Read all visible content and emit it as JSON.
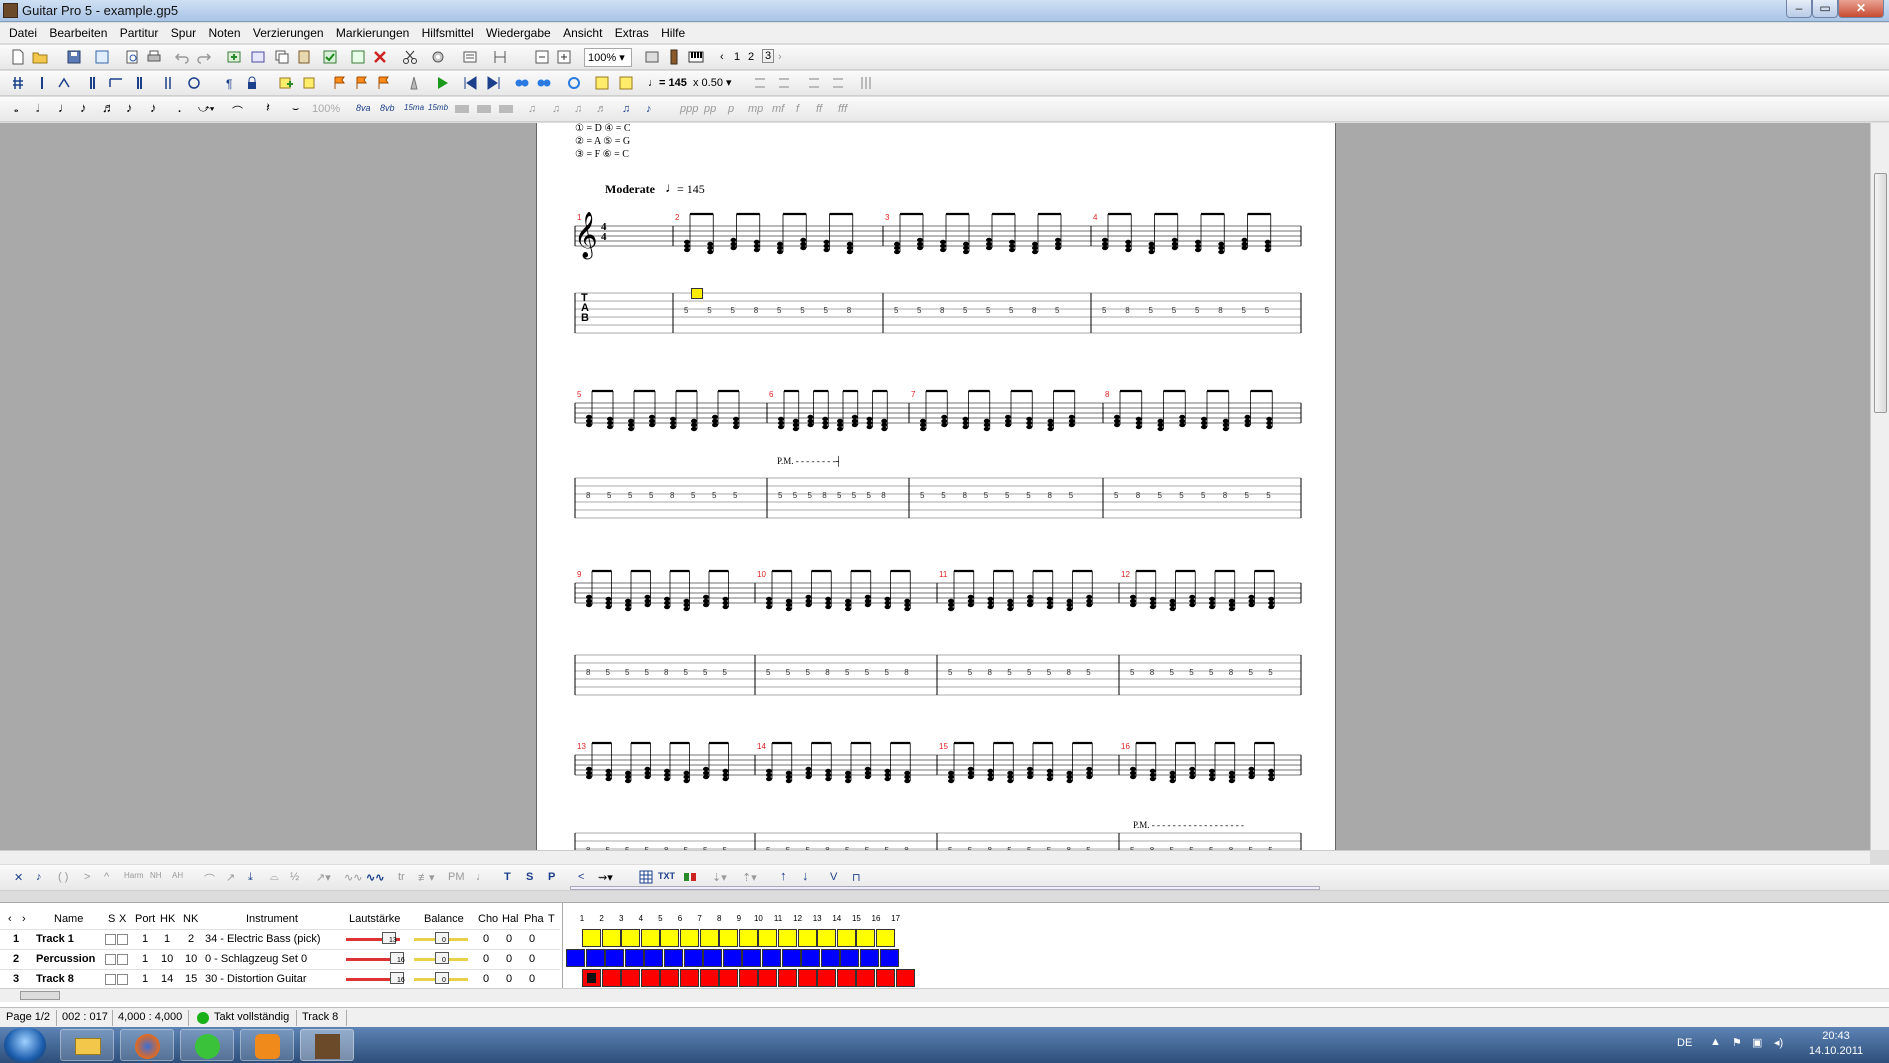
{
  "window": {
    "title": "Guitar Pro 5 - example.gp5"
  },
  "menu": [
    "Datei",
    "Bearbeiten",
    "Partitur",
    "Spur",
    "Noten",
    "Verzierungen",
    "Markierungen",
    "Hilfsmittel",
    "Wiedergabe",
    "Ansicht",
    "Extras",
    "Hilfe"
  ],
  "toolbar": {
    "zoom": "100%",
    "pages": [
      "1",
      "2",
      "3"
    ],
    "tempo": "♩= 145",
    "speed": "x 0.50",
    "percent": "100%",
    "octave_labels": [
      "8va",
      "8vb",
      "15ma",
      "15mb"
    ]
  },
  "score": {
    "tuning": [
      "① = D   ④ = C",
      "② = A   ⑤ = G",
      "③ = F   ⑥ = C"
    ],
    "tempo_text": "Moderate",
    "tempo_value": "= 145",
    "pm_label": "P.M.",
    "time_signature": "4/4",
    "tab_letters": [
      "T",
      "A",
      "B"
    ],
    "measure_numbers": [
      "1",
      "2",
      "3",
      "4",
      "5",
      "6",
      "7",
      "8",
      "9",
      "10",
      "11",
      "12",
      "13",
      "14",
      "15",
      "16"
    ]
  },
  "bottom_toolbar": {
    "txt": "TXT",
    "pm": "PM"
  },
  "tracks": {
    "headers": {
      "name": "Name",
      "s": "S",
      "x": "X",
      "port": "Port",
      "hk": "HK",
      "nk": "NK",
      "instrument": "Instrument",
      "volume": "Lautstärke",
      "balance": "Balance",
      "cho": "Cho",
      "hal": "Hal",
      "pha": "Pha",
      "t": "T"
    },
    "rows": [
      {
        "num": "1",
        "name": "Track 1",
        "port": "1",
        "hk": "1",
        "nk": "2",
        "instrument": "34 - Electric Bass (pick)",
        "volume": "13",
        "balance": "0",
        "cho": "0",
        "hal": "0",
        "pha": "0",
        "color": "#ffff00"
      },
      {
        "num": "2",
        "name": "Percussion",
        "port": "1",
        "hk": "10",
        "nk": "10",
        "instrument": "0 - Schlagzeug Set 0",
        "volume": "16",
        "balance": "0",
        "cho": "0",
        "hal": "0",
        "pha": "0",
        "color": "#0000ff"
      },
      {
        "num": "3",
        "name": "Track 8",
        "port": "1",
        "hk": "14",
        "nk": "15",
        "instrument": "30 - Distortion Guitar",
        "volume": "16",
        "balance": "0",
        "cho": "0",
        "hal": "0",
        "pha": "0",
        "color": "#ff0000"
      }
    ],
    "measure_count": 17
  },
  "status": {
    "page": "Page 1/2",
    "position": "002 : 017",
    "time": "4,000 : 4,000",
    "complete": "Takt vollständig",
    "track": "Track 8"
  },
  "taskbar": {
    "lang": "DE",
    "time": "20:43",
    "date": "14.10.2011"
  }
}
